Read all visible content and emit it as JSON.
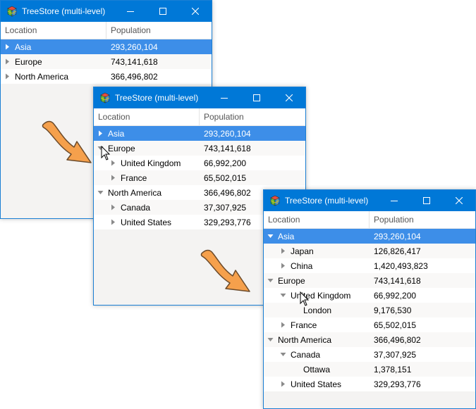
{
  "window_title": "TreeStore (multi-level)",
  "columns": {
    "location": "Location",
    "population": "Population"
  },
  "colors": {
    "titlebar": "#0078d7",
    "selection": "#3d8ee8",
    "arrow": "#f5a04c"
  },
  "windows": [
    {
      "rows": [
        {
          "label": "Asia",
          "population": "293,260,104",
          "state": "collapsed",
          "selected": true
        },
        {
          "label": "Europe",
          "population": "743,141,618",
          "state": "collapsed"
        },
        {
          "label": "North America",
          "population": "366,496,802",
          "state": "collapsed"
        }
      ]
    },
    {
      "rows": [
        {
          "label": "Asia",
          "population": "293,260,104",
          "state": "collapsed",
          "selected": true
        },
        {
          "label": "Europe",
          "population": "743,141,618",
          "state": "expanded"
        },
        {
          "label": "United Kingdom",
          "population": "66,992,200",
          "state": "collapsed"
        },
        {
          "label": "France",
          "population": "65,502,015",
          "state": "collapsed"
        },
        {
          "label": "North America",
          "population": "366,496,802",
          "state": "expanded"
        },
        {
          "label": "Canada",
          "population": "37,307,925",
          "state": "collapsed"
        },
        {
          "label": "United States",
          "population": "329,293,776",
          "state": "collapsed"
        }
      ]
    },
    {
      "rows": [
        {
          "label": "Asia",
          "population": "293,260,104",
          "state": "expanded",
          "selected": true
        },
        {
          "label": "Japan",
          "population": "126,826,417",
          "state": "collapsed"
        },
        {
          "label": "China",
          "population": "1,420,493,823",
          "state": "collapsed"
        },
        {
          "label": "Europe",
          "population": "743,141,618",
          "state": "expanded"
        },
        {
          "label": "United Kingdom",
          "population": "66,992,200",
          "state": "expanded"
        },
        {
          "label": "London",
          "population": "9,176,530",
          "state": "leaf"
        },
        {
          "label": "France",
          "population": "65,502,015",
          "state": "collapsed"
        },
        {
          "label": "North America",
          "population": "366,496,802",
          "state": "expanded"
        },
        {
          "label": "Canada",
          "population": "37,307,925",
          "state": "expanded"
        },
        {
          "label": "Ottawa",
          "population": "1,378,151",
          "state": "leaf"
        },
        {
          "label": "United States",
          "population": "329,293,776",
          "state": "collapsed"
        }
      ]
    }
  ]
}
